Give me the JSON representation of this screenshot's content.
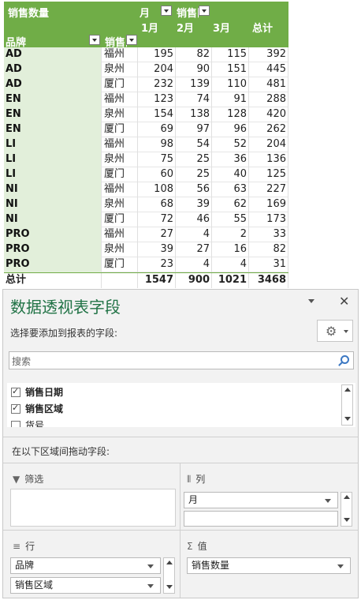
{
  "pivot": {
    "header": {
      "values_label": "销售数量",
      "month_field": "月",
      "region_field_col": "销售区域",
      "row_field": "品牌",
      "row_field2": "销售区域",
      "months": [
        "1月",
        "2月",
        "3月"
      ],
      "total_label": "总计"
    },
    "rows": [
      {
        "brand": "AD",
        "region": "福州",
        "m1": "195",
        "m2": "82",
        "m3": "115",
        "total": "392"
      },
      {
        "brand": "AD",
        "region": "泉州",
        "m1": "204",
        "m2": "90",
        "m3": "151",
        "total": "445"
      },
      {
        "brand": "AD",
        "region": "厦门",
        "m1": "232",
        "m2": "139",
        "m3": "110",
        "total": "481"
      },
      {
        "brand": "EN",
        "region": "福州",
        "m1": "123",
        "m2": "74",
        "m3": "91",
        "total": "288"
      },
      {
        "brand": "EN",
        "region": "泉州",
        "m1": "154",
        "m2": "138",
        "m3": "128",
        "total": "420"
      },
      {
        "brand": "EN",
        "region": "厦门",
        "m1": "69",
        "m2": "97",
        "m3": "96",
        "total": "262"
      },
      {
        "brand": "LI",
        "region": "福州",
        "m1": "98",
        "m2": "54",
        "m3": "52",
        "total": "204"
      },
      {
        "brand": "LI",
        "region": "泉州",
        "m1": "75",
        "m2": "25",
        "m3": "36",
        "total": "136"
      },
      {
        "brand": "LI",
        "region": "厦门",
        "m1": "60",
        "m2": "25",
        "m3": "40",
        "total": "125"
      },
      {
        "brand": "NI",
        "region": "福州",
        "m1": "108",
        "m2": "56",
        "m3": "63",
        "total": "227"
      },
      {
        "brand": "NI",
        "region": "泉州",
        "m1": "68",
        "m2": "39",
        "m3": "62",
        "total": "169"
      },
      {
        "brand": "NI",
        "region": "厦门",
        "m1": "72",
        "m2": "46",
        "m3": "55",
        "total": "173"
      },
      {
        "brand": "PRO",
        "region": "福州",
        "m1": "27",
        "m2": "4",
        "m3": "2",
        "total": "33"
      },
      {
        "brand": "PRO",
        "region": "泉州",
        "m1": "39",
        "m2": "27",
        "m3": "16",
        "total": "82"
      },
      {
        "brand": "PRO",
        "region": "厦门",
        "m1": "23",
        "m2": "4",
        "m3": "4",
        "total": "31"
      }
    ],
    "grand_total": {
      "label": "总计",
      "m1": "1547",
      "m2": "900",
      "m3": "1021",
      "total": "3468"
    }
  },
  "pane": {
    "title": "数据透视表字段",
    "close_glyph": "✕",
    "subtitle": "选择要添加到报表的字段:",
    "gear_glyph": "⚙",
    "search_placeholder": "搜索",
    "fields": [
      {
        "label": "销售日期",
        "checked": true
      },
      {
        "label": "销售区域",
        "checked": true
      },
      {
        "label": "货号",
        "checked": false
      }
    ],
    "drag_hint": "在以下区域间拖动字段:",
    "areas": {
      "filters": {
        "label": "筛选",
        "icon": "filter-icon"
      },
      "columns": {
        "label": "列",
        "icon": "columns-icon",
        "items": [
          "月",
          ""
        ]
      },
      "rows": {
        "label": "行",
        "icon": "rows-icon",
        "items": [
          "品牌",
          "销售区域"
        ]
      },
      "values": {
        "label": "值",
        "icon": "sigma-icon",
        "items": [
          "销售数量"
        ]
      }
    }
  },
  "colors": {
    "header_green": "#70ad47",
    "brand_fill": "#e2efda",
    "title_green": "#217346",
    "pane_bg": "#f2f2f2"
  }
}
